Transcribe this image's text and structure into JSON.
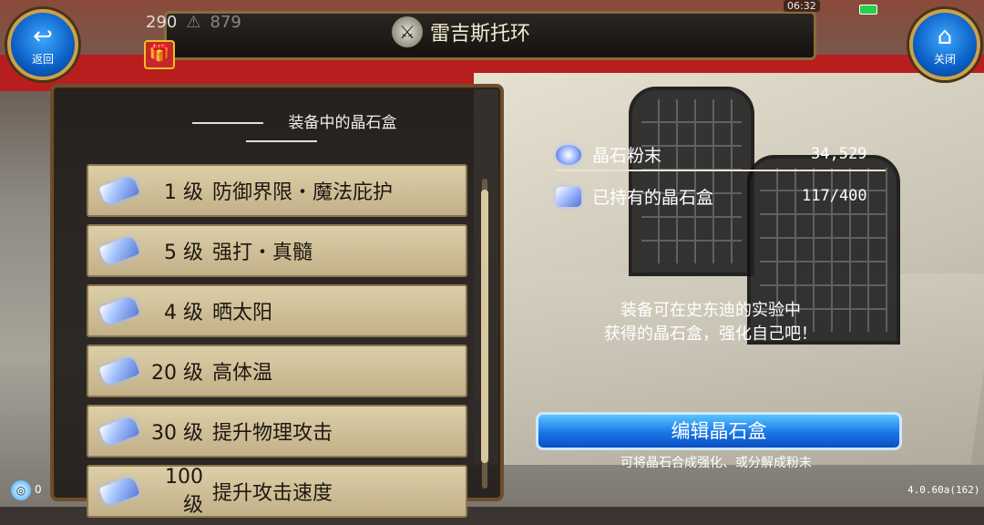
{
  "header": {
    "title": "雷吉斯托环",
    "title_icon": "character-emblem-icon",
    "currency1": "290",
    "currency2": "879",
    "clock": "06:32"
  },
  "nav": {
    "back_label": "返回",
    "close_label": "关闭"
  },
  "panel": {
    "heading": "装备中的晶石盒",
    "items": [
      {
        "level": "1 级",
        "name": "防御界限・魔法庇护"
      },
      {
        "level": "5 级",
        "name": "强打・真髓"
      },
      {
        "level": "4 级",
        "name": "晒太阳"
      },
      {
        "level": "20 级",
        "name": "高体温"
      },
      {
        "level": "30 级",
        "name": "提升物理攻击"
      },
      {
        "level": "100级",
        "name": "提升攻击速度"
      }
    ]
  },
  "info": {
    "dust_label": "晶石粉末",
    "dust_value": "34,529",
    "owned_label": "已持有的晶石盒",
    "owned_value": "117/400"
  },
  "message_line1": "装备可在史东迪的实验中",
  "message_line2": "获得的晶石盒，强化自己吧！",
  "edit_button": "编辑晶石盒",
  "hint": "可将晶石合成强化、或分解成粉末",
  "version": "4.0.60a(162)",
  "corner_number": "0",
  "colors": {
    "accent_blue": "#1976e8",
    "frame_gold": "#c9a24a",
    "row_bg": "#dccfa8"
  }
}
